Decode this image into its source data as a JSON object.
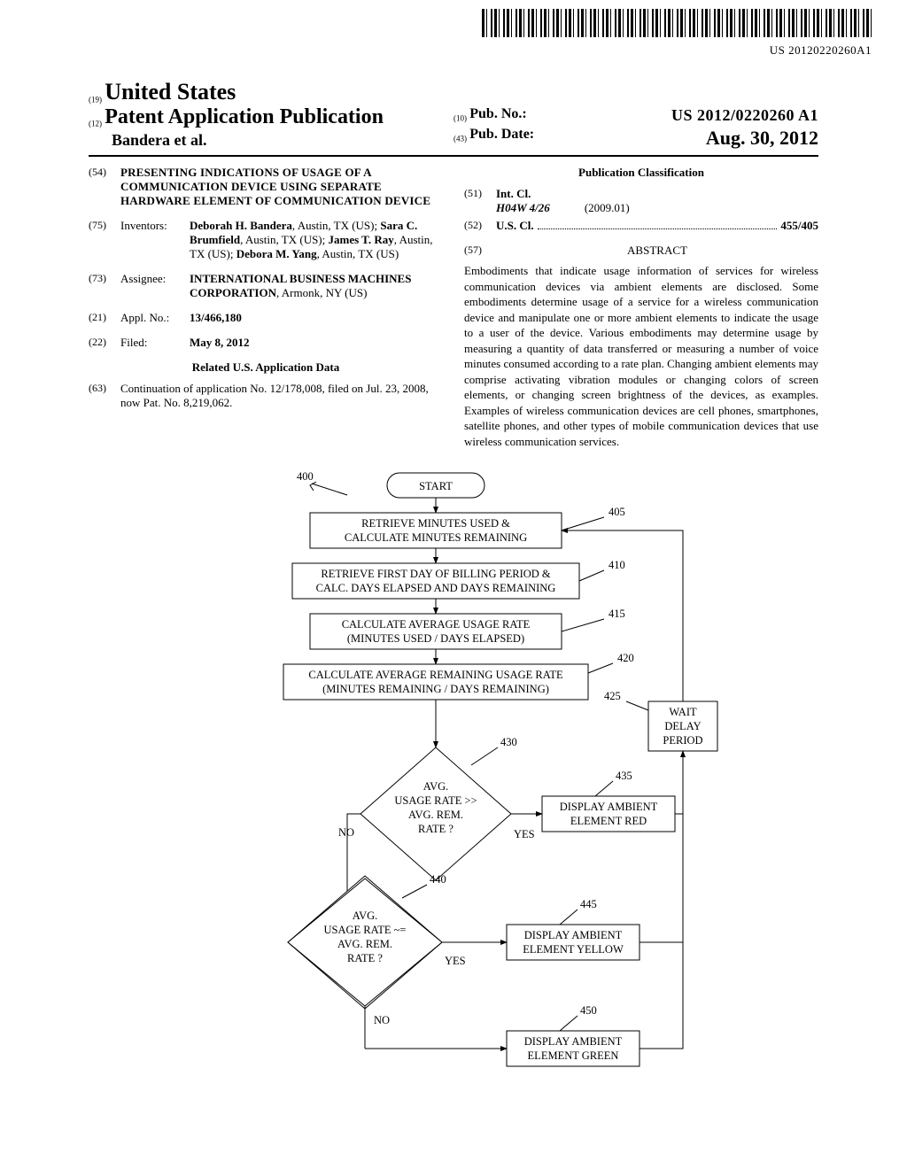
{
  "barcode_text": "US 20120220260A1",
  "header": {
    "code19": "(19)",
    "country": "United States",
    "code12": "(12)",
    "pubtype": "Patent Application Publication",
    "authors": "Bandera et al.",
    "code10": "(10)",
    "pubno_label": "Pub. No.:",
    "pubno_value": "US 2012/0220260 A1",
    "code43": "(43)",
    "pubdate_label": "Pub. Date:",
    "pubdate_value": "Aug. 30, 2012"
  },
  "field54": {
    "code": "(54)",
    "title": "PRESENTING INDICATIONS OF USAGE OF A COMMUNICATION DEVICE USING SEPARATE HARDWARE ELEMENT OF COMMUNICATION DEVICE"
  },
  "field75": {
    "code": "(75)",
    "label": "Inventors:",
    "value": "Deborah H. Bandera, Austin, TX (US); Sara C. Brumfield, Austin, TX (US); James T. Ray, Austin, TX (US); Debora M. Yang, Austin, TX (US)"
  },
  "field73": {
    "code": "(73)",
    "label": "Assignee:",
    "value": "INTERNATIONAL BUSINESS MACHINES CORPORATION, Armonk, NY (US)"
  },
  "field21": {
    "code": "(21)",
    "label": "Appl. No.:",
    "value": "13/466,180"
  },
  "field22": {
    "code": "(22)",
    "label": "Filed:",
    "value": "May 8, 2012"
  },
  "related_heading": "Related U.S. Application Data",
  "field63": {
    "code": "(63)",
    "value": "Continuation of application No. 12/178,008, filed on Jul. 23, 2008, now Pat. No. 8,219,062."
  },
  "classification_heading": "Publication Classification",
  "field51": {
    "code": "(51)",
    "label": "Int. Cl.",
    "class": "H04W 4/26",
    "date": "(2009.01)"
  },
  "field52": {
    "code": "(52)",
    "label": "U.S. Cl.",
    "value": "455/405"
  },
  "field57": {
    "code": "(57)",
    "label": "ABSTRACT"
  },
  "abstract": "Embodiments that indicate usage information of services for wireless communication devices via ambient elements are disclosed. Some embodiments determine usage of a service for a wireless communication device and manipulate one or more ambient elements to indicate the usage to a user of the device. Various embodiments may determine usage by measuring a quantity of data transferred or measuring a number of voice minutes consumed according to a rate plan. Changing ambient elements may comprise activating vibration modules or changing colors of screen elements, or changing screen brightness of the devices, as examples. Examples of wireless communication devices are cell phones, smartphones, satellite phones, and other types of mobile communication devices that use wireless communication services.",
  "figure": {
    "ref": "400",
    "start": "START",
    "box405": {
      "num": "405",
      "l1": "RETRIEVE MINUTES USED &",
      "l2": "CALCULATE MINUTES REMAINING"
    },
    "box410": {
      "num": "410",
      "l1": "RETRIEVE FIRST DAY OF BILLING PERIOD  &",
      "l2": "CALC. DAYS ELAPSED AND DAYS REMAINING"
    },
    "box415": {
      "num": "415",
      "l1": "CALCULATE AVERAGE USAGE RATE",
      "l2": "(MINUTES USED / DAYS ELAPSED)"
    },
    "box420": {
      "num": "420",
      "l1": "CALCULATE AVERAGE REMAINING USAGE RATE",
      "l2": "(MINUTES REMAINING / DAYS REMAINING)"
    },
    "box425": {
      "num": "425",
      "l1": "WAIT",
      "l2": "DELAY",
      "l3": "PERIOD"
    },
    "dia430": {
      "num": "430",
      "l1": "AVG.",
      "l2": "USAGE RATE >>",
      "l3": "AVG. REM.",
      "l4": "RATE ?"
    },
    "box435": {
      "num": "435",
      "l1": "DISPLAY AMBIENT",
      "l2": "ELEMENT RED"
    },
    "dia440": {
      "num": "440",
      "l1": "AVG.",
      "l2": "USAGE RATE ~=",
      "l3": "AVG. REM.",
      "l4": "RATE ?"
    },
    "box445": {
      "num": "445",
      "l1": "DISPLAY AMBIENT",
      "l2": "ELEMENT YELLOW"
    },
    "box450": {
      "num": "450",
      "l1": "DISPLAY AMBIENT",
      "l2": "ELEMENT GREEN"
    },
    "yes": "YES",
    "no": "NO"
  }
}
